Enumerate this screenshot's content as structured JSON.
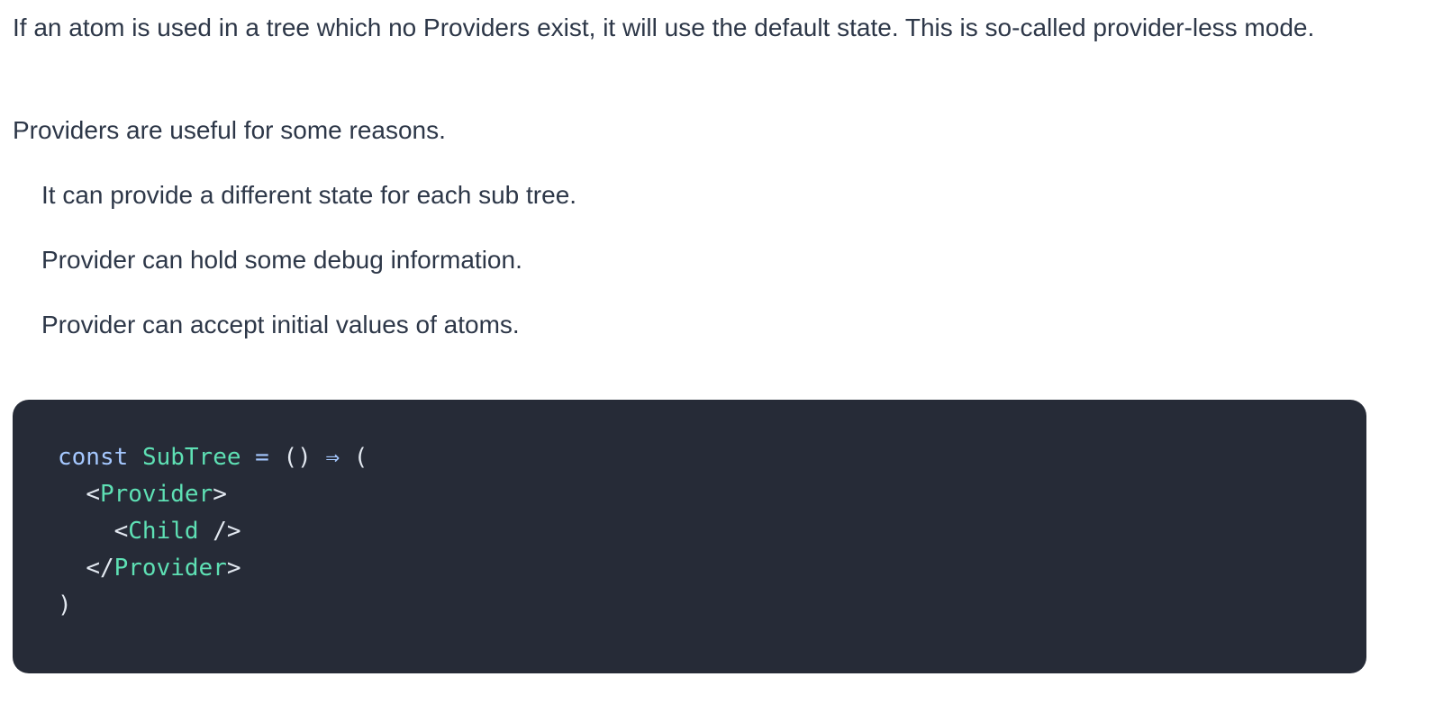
{
  "paragraphs": {
    "intro": "If an atom is used in a tree which no Providers exist, it will use the default state. This is so-called provider-less mode.",
    "reasons_lead": "Providers are useful for some reasons."
  },
  "reasons": [
    "It can provide a different state for each sub tree.",
    "Provider can hold some debug information.",
    "Provider can accept initial values of atoms."
  ],
  "code": {
    "line1": {
      "keyword": "const",
      "name": "SubTree",
      "eq": "=",
      "parens": "()",
      "arrow": "⇒",
      "open": "("
    },
    "line2": {
      "lt": "<",
      "tag": "Provider",
      "gt": ">"
    },
    "line3": {
      "lt": "<",
      "tag": "Child",
      "close": " />"
    },
    "line4": {
      "lt": "</",
      "tag": "Provider",
      "gt": ">"
    },
    "line5": {
      "close": ")"
    }
  }
}
